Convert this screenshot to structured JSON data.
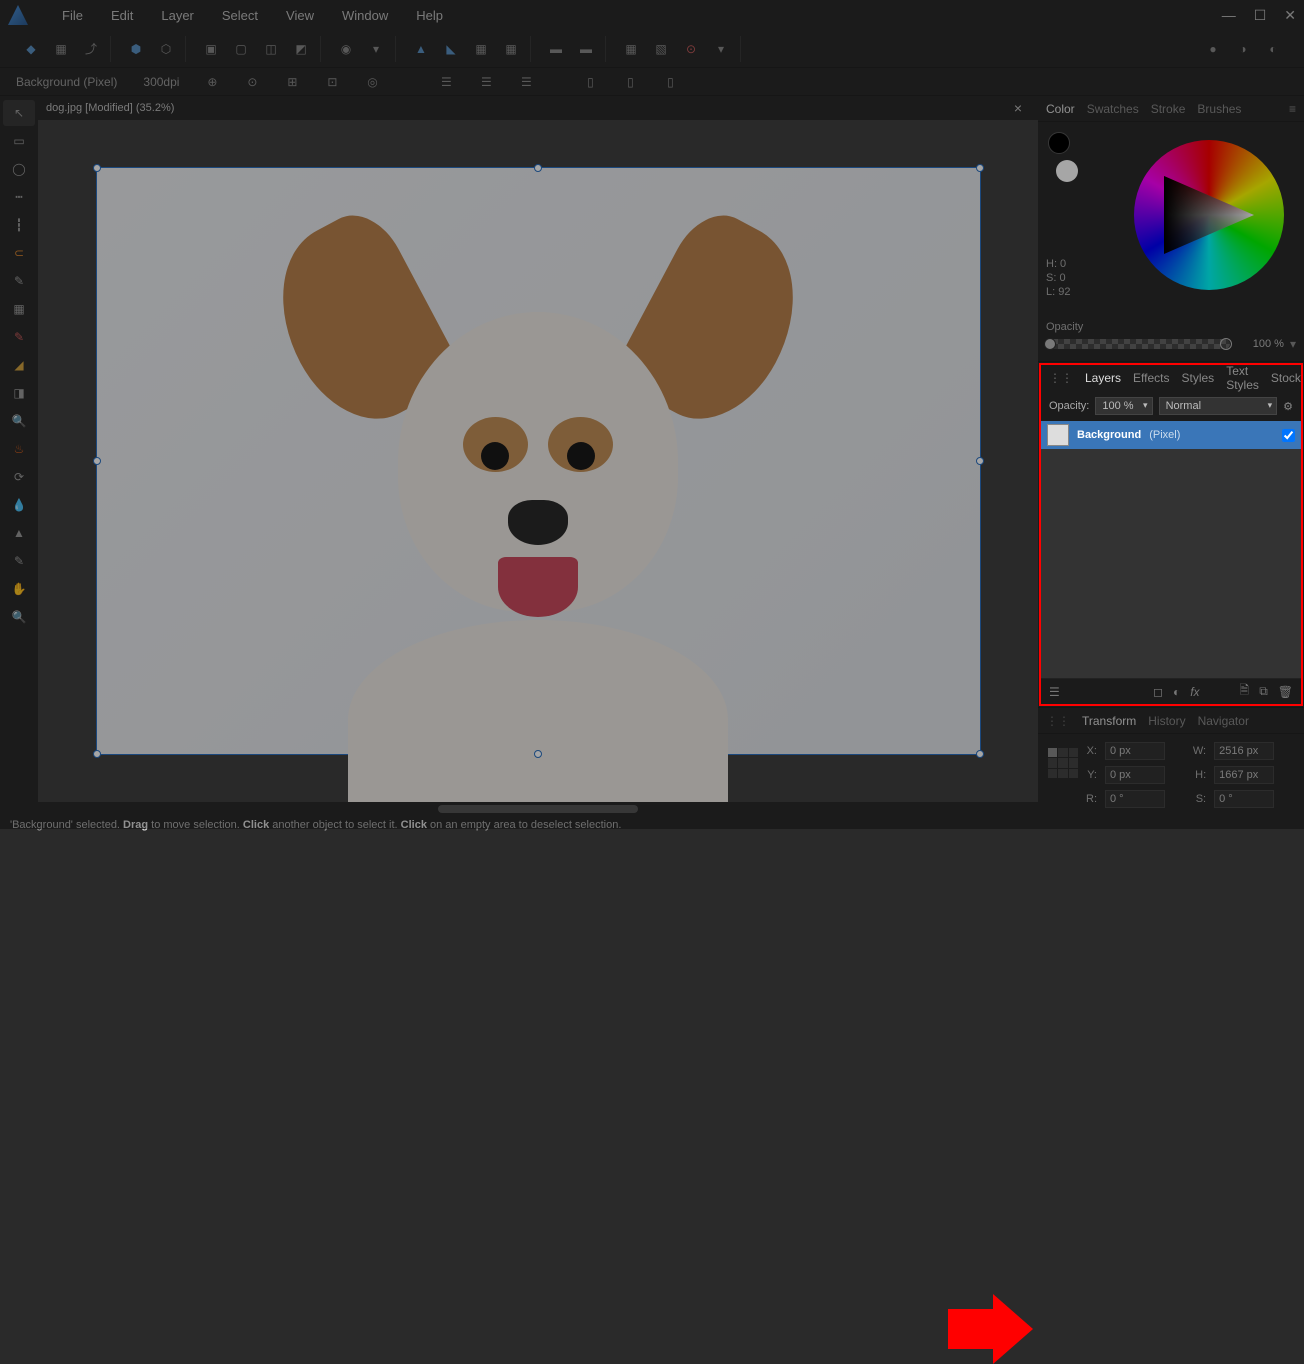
{
  "menubar": {
    "items": [
      "File",
      "Edit",
      "Layer",
      "Select",
      "View",
      "Window",
      "Help"
    ]
  },
  "context_bar": {
    "layer_info": "Background (Pixel)",
    "dpi": "300dpi"
  },
  "document_tab": {
    "label": "dog.jpg [Modified] (35.2%)"
  },
  "color_panel": {
    "tabs": [
      "Color",
      "Swatches",
      "Stroke",
      "Brushes"
    ],
    "active_tab": "Color",
    "hsl": {
      "h": "H: 0",
      "s": "S: 0",
      "l": "L: 92"
    },
    "opacity_label": "Opacity",
    "opacity_value": "100 %"
  },
  "layers_panel": {
    "tabs": [
      "Layers",
      "Effects",
      "Styles",
      "Text Styles",
      "Stock"
    ],
    "active_tab": "Layers",
    "opacity_label": "Opacity:",
    "opacity_value": "100 %",
    "blend_mode": "Normal",
    "layers": [
      {
        "name": "Background",
        "type": "(Pixel)",
        "visible": true,
        "selected": true
      }
    ]
  },
  "transform_panel": {
    "tabs": [
      "Transform",
      "History",
      "Navigator"
    ],
    "active_tab": "Transform",
    "x_label": "X:",
    "x_value": "0 px",
    "y_label": "Y:",
    "y_value": "0 px",
    "w_label": "W:",
    "w_value": "2516 px",
    "h_label": "H:",
    "h_value": "1667 px",
    "r_label": "R:",
    "r_value": "0 °",
    "s_label": "S:",
    "s_value": "0 °"
  },
  "status_bar": {
    "text_1": "'Background' selected. ",
    "bold_1": "Drag",
    "text_2": " to move selection. ",
    "bold_2": "Click",
    "text_3": " another object to select it. ",
    "bold_3": "Click",
    "text_4": " on an empty area to deselect selection."
  }
}
